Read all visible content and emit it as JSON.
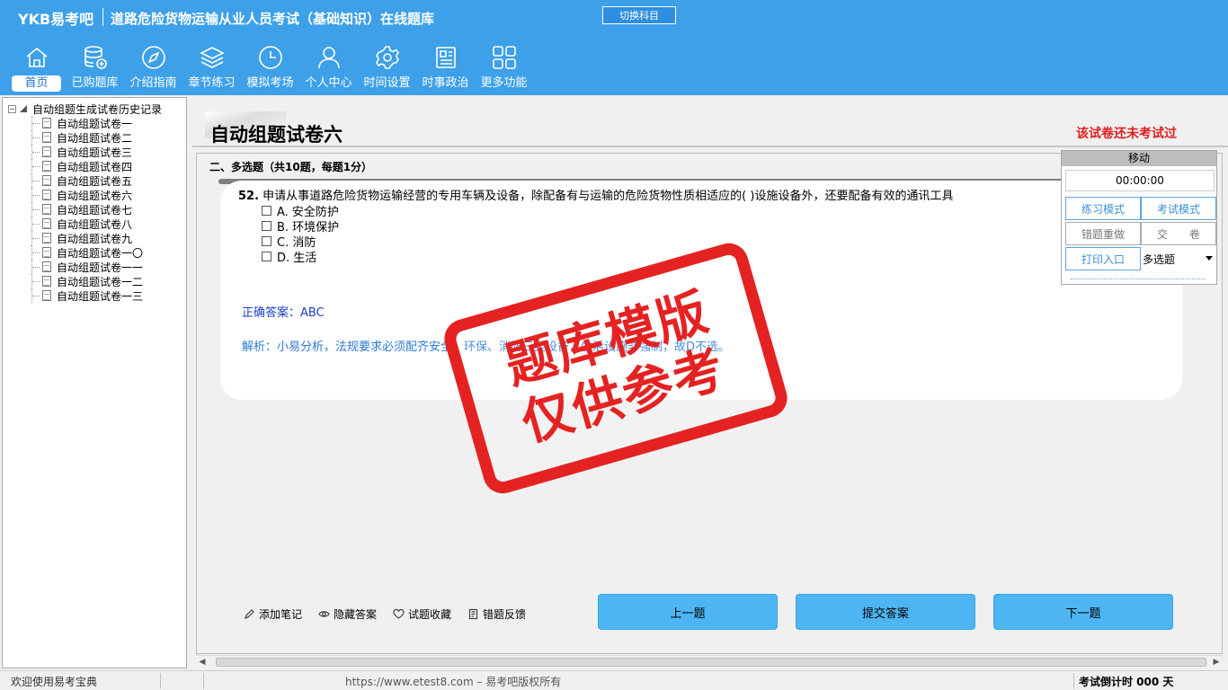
{
  "header": {
    "logo": "YKB易考吧",
    "title": "道路危险货物运输从业人员考试（基础知识）在线题库",
    "switch_subject": "切换科目"
  },
  "nav": [
    {
      "label": "首页",
      "icon": "home-icon"
    },
    {
      "label": "已购题库",
      "icon": "database-icon"
    },
    {
      "label": "介绍指南",
      "icon": "compass-icon"
    },
    {
      "label": "章节练习",
      "icon": "layers-icon"
    },
    {
      "label": "模拟考场",
      "icon": "clock-icon"
    },
    {
      "label": "个人中心",
      "icon": "user-icon"
    },
    {
      "label": "时间设置",
      "icon": "gear-icon"
    },
    {
      "label": "时事政治",
      "icon": "news-icon"
    },
    {
      "label": "更多功能",
      "icon": "grid-icon"
    }
  ],
  "sidebar": {
    "root": "自动组题生成试卷历史记录",
    "items": [
      "自动组题试卷一",
      "自动组题试卷二",
      "自动组题试卷三",
      "自动组题试卷四",
      "自动组题试卷五",
      "自动组题试卷六",
      "自动组题试卷七",
      "自动组题试卷八",
      "自动组题试卷九",
      "自动组题试卷一〇",
      "自动组题试卷一一",
      "自动组题试卷一二",
      "自动组题试卷一三"
    ]
  },
  "paper": {
    "title": "自动组题试卷六",
    "status": "该试卷还未考试过"
  },
  "section": {
    "label": "二、多选题（共10题，每题1分）"
  },
  "question": {
    "number": "52.",
    "text": "申请从事道路危险货物运输经营的专用车辆及设备，除配备有与运输的危险货物性质相适应的(  )设施设备外，还要配备有效的通讯工具",
    "options": [
      "A. 安全防护",
      "B. 环境保护",
      "C. 消防",
      "D. 生活"
    ],
    "answer_label": "正确答案：",
    "answer": "ABC",
    "analysis": "解析：小易分析，法规要求必须配齐安全、环保、消防三类设备，生活设施非强制，故D不选。"
  },
  "stamp": {
    "line1": "题库模版",
    "line2": "仅供参考"
  },
  "bottom_links": [
    "添加笔记",
    "隐藏答案",
    "试题收藏",
    "错题反馈"
  ],
  "buttons": {
    "prev": "上一题",
    "submit": "提交答案",
    "next": "下一题"
  },
  "control_panel": {
    "move": "移动",
    "timer": "00:00:00",
    "practice_mode": "练习模式",
    "exam_mode": "考试模式",
    "redo_wrong": "错题重做",
    "hand_in": "交　　卷",
    "print": "打印入口",
    "question_type": "多选题"
  },
  "statusbar": {
    "welcome": "欢迎使用易考宝典",
    "url": "https://www.etest8.com – 易考吧版权所有",
    "countdown": "考试倒计时 000 天"
  }
}
